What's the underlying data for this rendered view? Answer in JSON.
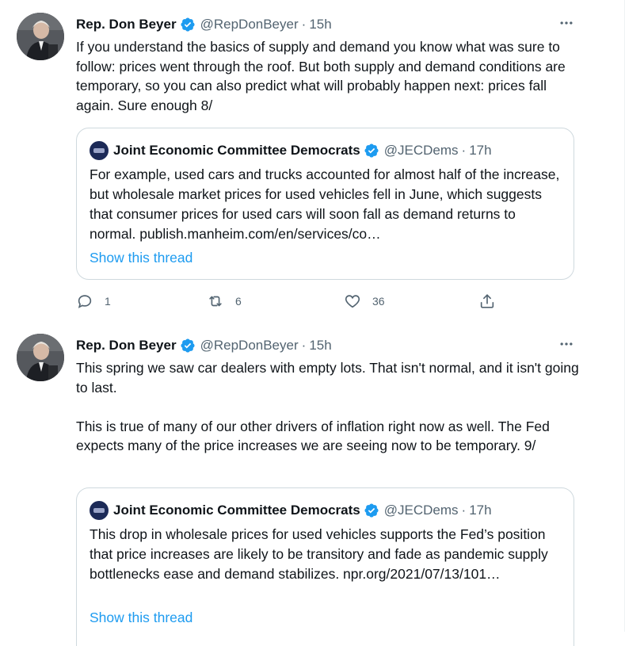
{
  "tweets": [
    {
      "author": {
        "name": "Rep. Don Beyer",
        "handle": "@RepDonBeyer",
        "time": "15h",
        "verified": true
      },
      "text": [
        "If you understand the basics of supply and demand you know what was sure to follow: prices went through the roof. But both supply and demand conditions are temporary, so you can also predict what will probably happen next: prices fall again. Sure enough 8/"
      ],
      "quote": {
        "author": {
          "name": "Joint Economic Committee Democrats",
          "handle": "@JECDems",
          "time": "17h",
          "verified": true
        },
        "text": "For example, used cars and trucks accounted for almost half of the increase, but wholesale market prices for used vehicles fell in June, which suggests that consumer prices for used cars will soon fall as demand returns to normal. publish.manheim.com/en/services/co…",
        "link_label": "Show this thread"
      },
      "actions": {
        "reply_count": "1",
        "retweet_count": "6",
        "like_count": "36"
      }
    },
    {
      "author": {
        "name": "Rep. Don Beyer",
        "handle": "@RepDonBeyer",
        "time": "15h",
        "verified": true
      },
      "text": [
        "This spring we saw car dealers with empty lots. That isn't normal, and it isn't going to last.",
        "This is true of many of our other drivers of inflation right now as well. The Fed expects many of the price increases we are seeing now to be temporary. 9/"
      ],
      "quote": {
        "author": {
          "name": "Joint Economic Committee Democrats",
          "handle": "@JECDems",
          "time": "17h",
          "verified": true
        },
        "text": "This drop in wholesale prices for used vehicles supports the Fed’s position that price increases are likely to be transitory and fade as pandemic supply bottlenecks ease and demand stabilizes. npr.org/2021/07/13/101…",
        "link_label": "Show this thread"
      }
    }
  ],
  "ui": {
    "separator": "·",
    "more_icon": "more-horizontal-icon",
    "accent_color": "#1d9bf0",
    "muted_color": "#536471",
    "verified_color": "#1d9bf0"
  }
}
